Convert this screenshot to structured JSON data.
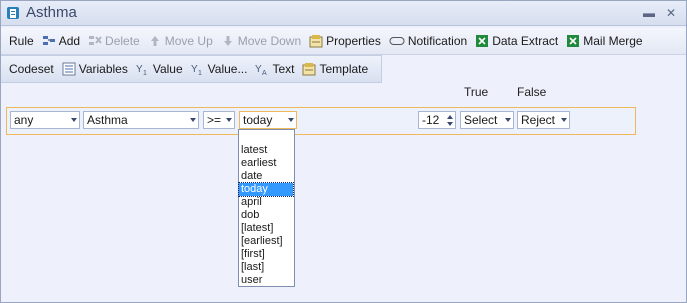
{
  "window": {
    "title": "Asthma"
  },
  "toolbar1": {
    "rule": "Rule",
    "add": "Add",
    "delete": "Delete",
    "move_up": "Move Up",
    "move_down": "Move Down",
    "properties": "Properties",
    "notification": "Notification",
    "data_extract": "Data Extract",
    "mail_merge": "Mail Merge"
  },
  "toolbar2": {
    "codeset": "Codeset",
    "variables": "Variables",
    "value": "Value",
    "value_more": "Value...",
    "text": "Text",
    "template": "Template"
  },
  "columns": {
    "true": "True",
    "false": "False"
  },
  "rule": {
    "quantifier": "any",
    "codeset": "Asthma",
    "operator": ">=",
    "date_ref": "today",
    "offset": "-12",
    "true_action": "Select",
    "false_action": "Reject"
  },
  "dropdown": {
    "items": [
      "latest",
      "earliest",
      "date",
      "today",
      "april",
      "dob",
      "[latest]",
      "[earliest]",
      "[first]",
      "[last]",
      "user"
    ],
    "selected": "today"
  },
  "colors": {
    "highlight": "#3399ff",
    "focus_border": "#f0b85c"
  }
}
